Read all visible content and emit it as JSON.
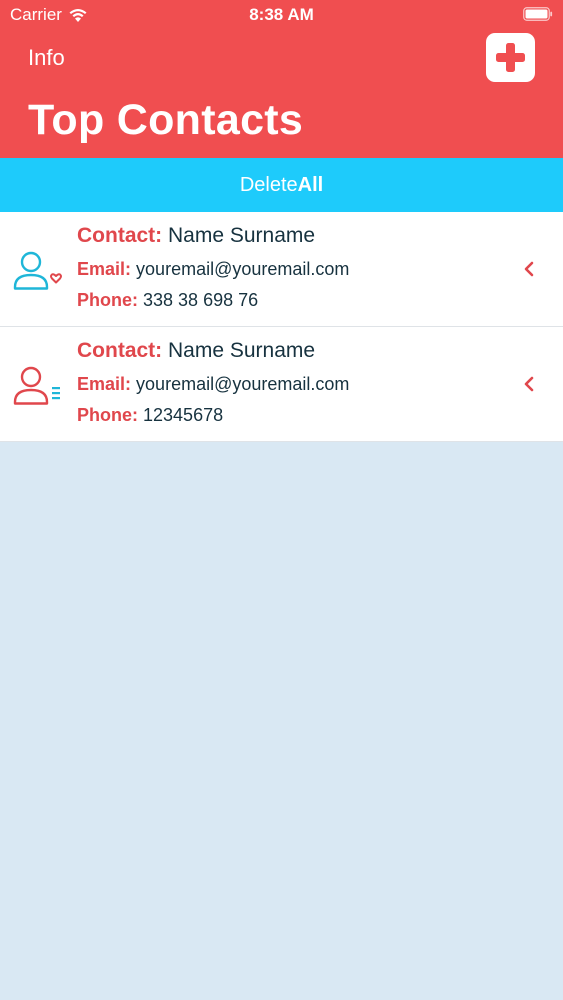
{
  "status_bar": {
    "carrier": "Carrier",
    "time": "8:38 AM"
  },
  "header": {
    "info_label": "Info",
    "title": "Top Contacts",
    "background_color": "#f04e50"
  },
  "delete_bar": {
    "prefix": "Delete",
    "suffix": "All",
    "background_color": "#1ecbfb"
  },
  "contacts": [
    {
      "contact_label": "Contact:",
      "name": "Name Surname",
      "email_label": "Email:",
      "email": "youremail@youremail.com",
      "phone_label": "Phone:",
      "phone": "338 38 698 76",
      "icon": "user-heart-icon",
      "icon_color": "#1fb6d8"
    },
    {
      "contact_label": "Contact:",
      "name": "Name Surname",
      "email_label": "Email:",
      "email": "youremail@youremail.com",
      "phone_label": "Phone:",
      "phone": "12345678",
      "icon": "user-list-icon",
      "icon_color": "#e0474c"
    }
  ],
  "colors": {
    "label_red": "#e0474c",
    "text_dark": "#17323f",
    "background": "#d9e8f3"
  }
}
